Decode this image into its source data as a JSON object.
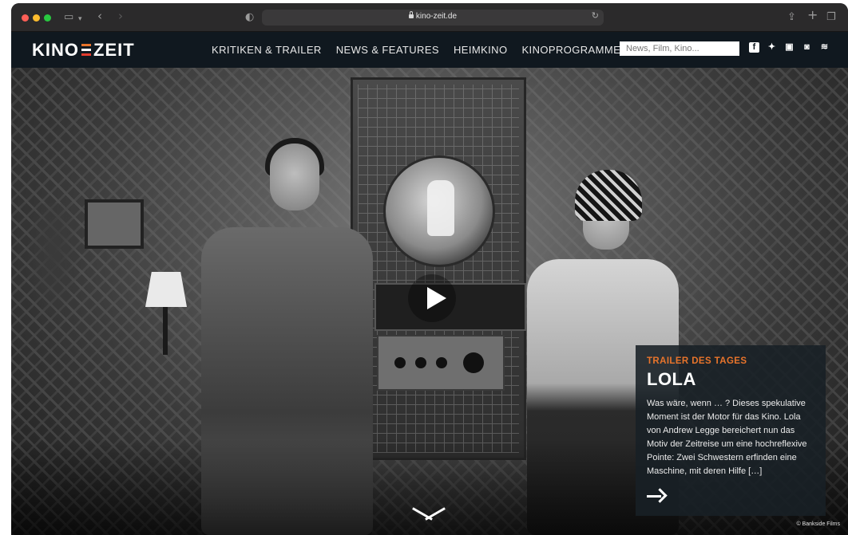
{
  "browser": {
    "url": "kino-zeit.de",
    "icons": [
      "sidebar-icon",
      "chevron-down-icon",
      "back-icon",
      "forward-icon",
      "privacy-shield-icon",
      "reload-icon",
      "share-icon",
      "new-tab-icon",
      "tabs-overview-icon"
    ]
  },
  "site": {
    "logo": {
      "left": "KINO",
      "right": "ZEIT"
    },
    "nav": [
      "KRITIKEN & TRAILER",
      "NEWS & FEATURES",
      "HEIMKINO",
      "KINOPROGRAMME"
    ],
    "search": {
      "placeholder": "News, Film, Kino..."
    },
    "social_icons": [
      "facebook-icon",
      "twitter-icon",
      "youtube-icon",
      "instagram-icon",
      "rss-icon"
    ]
  },
  "hero": {
    "feature": {
      "kicker": "TRAILER DES TAGES",
      "title": "LOLA",
      "text": "Was wäre, wenn … ? Dieses spekulative Moment ist der Motor für das Kino. Lola von Andrew Legge bereichert nun das Motiv der Zeitreise um eine hochreflexive Pointe: Zwei Schwestern erfinden eine Maschine, mit deren Hilfe […]"
    },
    "credit": "© Bankside Films"
  },
  "colors": {
    "accent": "#e8742b",
    "header_bg": "#10181f",
    "logo_mark": [
      "#e8742b",
      "#ffffff",
      "#e23b2e"
    ]
  }
}
